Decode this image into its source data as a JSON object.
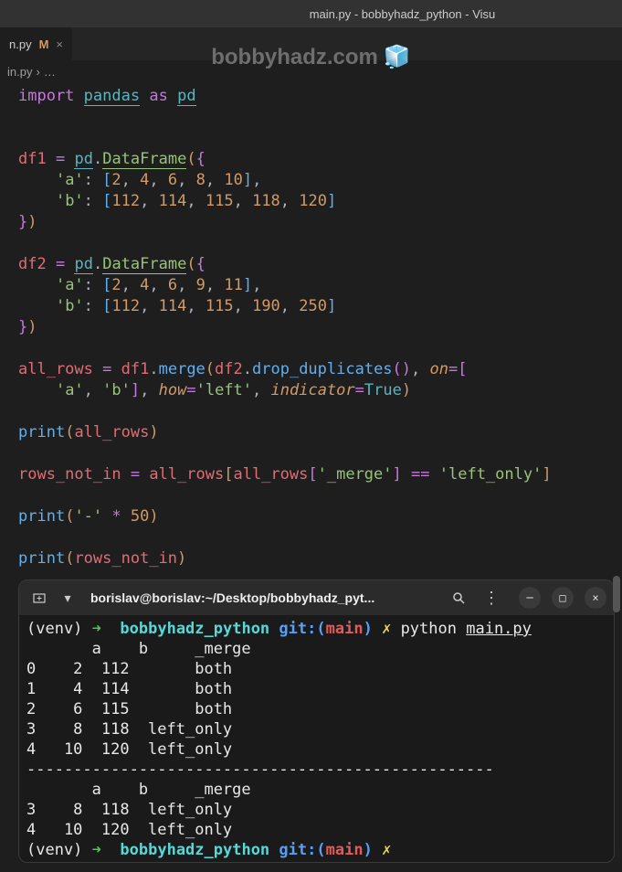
{
  "window": {
    "title": "main.py - bobbyhadz_python - Visu"
  },
  "tab": {
    "label": "n.py",
    "modified": "M",
    "close": "×"
  },
  "breadcrumb": {
    "file": "in.py",
    "sep": "›",
    "more": "…"
  },
  "watermark": {
    "text": "bobbyhadz.com",
    "icon": "🧊"
  },
  "code": {
    "l1_import": "import",
    "l1_pandas": "pandas",
    "l1_as": "as",
    "l1_pd": "pd",
    "df1": "df1",
    "df2": "df2",
    "eq": "=",
    "pd": "pd",
    "dot": ".",
    "DataFrame": "DataFrame",
    "ob": "(",
    "cb": ")",
    "ocb": "{",
    "ccb": "}",
    "osb": "[",
    "csb": "]",
    "comma": ",",
    "colon": ":",
    "key_a": "'a'",
    "key_b": "'b'",
    "df1_a": [
      "2",
      "4",
      "6",
      "8",
      "10"
    ],
    "df1_b": [
      "112",
      "114",
      "115",
      "118",
      "120"
    ],
    "df2_a": [
      "2",
      "4",
      "6",
      "9",
      "11"
    ],
    "df2_b": [
      "112",
      "114",
      "115",
      "190",
      "250"
    ],
    "all_rows": "all_rows",
    "merge": "merge",
    "drop_duplicates": "drop_duplicates",
    "on": "on",
    "how": "how",
    "how_val": "'left'",
    "indicator": "indicator",
    "True": "True",
    "print": "print",
    "rows_not_in": "rows_not_in",
    "merge_col": "'_merge'",
    "eqeq": "==",
    "left_only": "'left_only'",
    "dash": "'-'",
    "star": "*",
    "fifty": "50"
  },
  "terminal": {
    "title": "borislav@borislav:~/Desktop/bobbyhadz_pyt...",
    "prompt_venv": "(venv)",
    "prompt_arrow": "➜",
    "prompt_dir": "bobbyhadz_python",
    "prompt_git": "git:(",
    "prompt_branch": "main",
    "prompt_git_close": ")",
    "prompt_x": "✗",
    "cmd_python": "python",
    "cmd_file": "main.py",
    "output": [
      "       a    b     _merge",
      "0    2  112       both",
      "1    4  114       both",
      "2    6  115       both",
      "3    8  118  left_only",
      "4   10  120  left_only",
      "--------------------------------------------------",
      "       a    b     _merge",
      "3    8  118  left_only",
      "4   10  120  left_only"
    ]
  }
}
